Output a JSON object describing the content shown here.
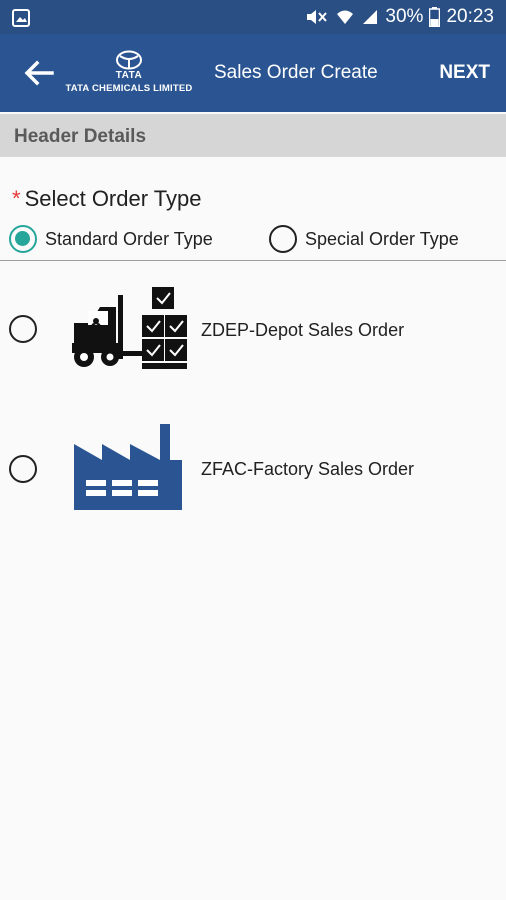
{
  "status_bar": {
    "battery": "30%",
    "time": "20:23"
  },
  "app_bar": {
    "brand_word": "TATA",
    "company": "TATA CHEMICALS LIMITED",
    "title": "Sales Order Create",
    "next_label": "NEXT"
  },
  "section": {
    "title": "Header Details"
  },
  "order_type": {
    "required_mark": "*",
    "label": "Select Order Type",
    "options": [
      {
        "label": "Standard Order Type",
        "selected": true
      },
      {
        "label": "Special Order Type",
        "selected": false
      }
    ]
  },
  "orders": [
    {
      "label": "ZDEP-Depot  Sales Order",
      "icon": "forklift-icon",
      "selected": false
    },
    {
      "label": "ZFAC-Factory Sales Order",
      "icon": "factory-icon",
      "selected": false
    }
  ],
  "colors": {
    "app_bar": "#2a5592",
    "status_bar": "#2a4f84",
    "accent": "#26a69a",
    "required": "#e53935"
  }
}
